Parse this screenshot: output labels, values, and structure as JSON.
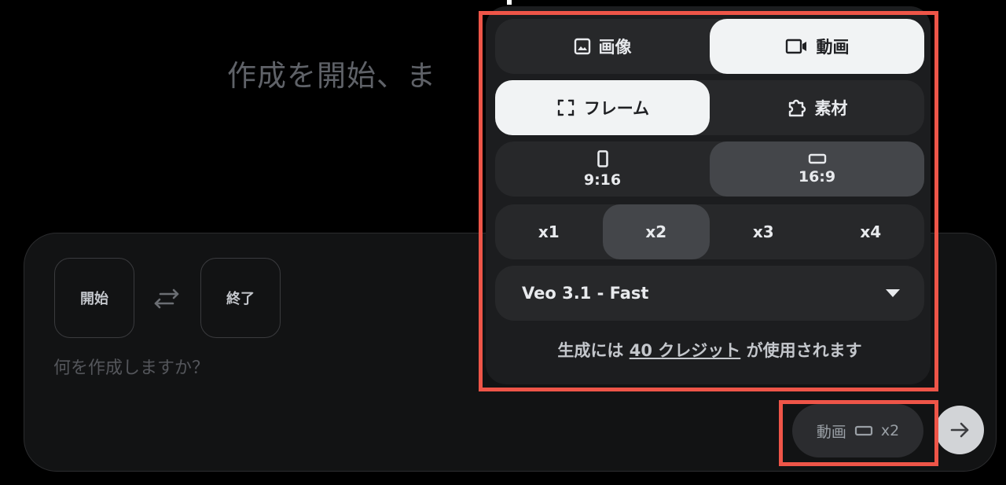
{
  "heading": "作成を開始、ま",
  "frames": {
    "start_label": "開始",
    "end_label": "終了",
    "swap_icon": "swap-arrows-icon"
  },
  "prompt": {
    "placeholder": "何を作成しますか？",
    "value": ""
  },
  "mode_chip": {
    "label": "動画",
    "icon": "landscape-frame-icon",
    "count": "x2"
  },
  "send_icon": "arrow-right-icon",
  "popover": {
    "media_type": [
      {
        "label": "画像",
        "icon": "image-icon",
        "active": false
      },
      {
        "label": "動画",
        "icon": "video-camera-icon",
        "active": true
      }
    ],
    "source": [
      {
        "label": "フレーム",
        "icon": "frame-corners-icon",
        "active": true
      },
      {
        "label": "素材",
        "icon": "puzzle-piece-icon",
        "active": false
      }
    ],
    "aspect_ratio": [
      {
        "label": "9:16",
        "icon": "portrait-frame-icon",
        "active": false
      },
      {
        "label": "16:9",
        "icon": "landscape-frame-icon",
        "active": true
      }
    ],
    "count": [
      {
        "label": "x1",
        "active": false
      },
      {
        "label": "x2",
        "active": true
      },
      {
        "label": "x3",
        "active": false
      },
      {
        "label": "x4",
        "active": false
      }
    ],
    "model": {
      "value": "Veo 3.1 - Fast",
      "icon": "dropdown-triangle-icon"
    },
    "credits": {
      "prefix": "生成には",
      "link": "40 クレジット",
      "suffix": "が使用されます"
    }
  },
  "colors": {
    "highlight": "#ee5548",
    "panel": "#1c1d1f",
    "segment": "#27282a",
    "active_light": "#f1f3f4",
    "active_dark": "#44464a"
  }
}
